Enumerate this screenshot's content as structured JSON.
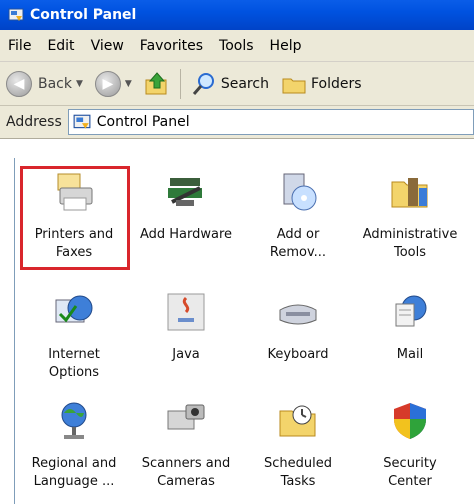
{
  "window": {
    "title": "Control Panel"
  },
  "menu": [
    "File",
    "Edit",
    "View",
    "Favorites",
    "Tools",
    "Help"
  ],
  "toolbar": {
    "back": "Back",
    "search": "Search",
    "folders": "Folders"
  },
  "address": {
    "label": "Address",
    "value": "Control Panel"
  },
  "items": [
    {
      "label1": "Printers and",
      "label2": "Faxes"
    },
    {
      "label1": "Add Hardware",
      "label2": ""
    },
    {
      "label1": "Add or",
      "label2": "Remov..."
    },
    {
      "label1": "Administrative",
      "label2": "Tools"
    },
    {
      "label1": "Internet",
      "label2": "Options"
    },
    {
      "label1": "Java",
      "label2": ""
    },
    {
      "label1": "Keyboard",
      "label2": ""
    },
    {
      "label1": "Mail",
      "label2": ""
    },
    {
      "label1": "Regional and",
      "label2": "Language ..."
    },
    {
      "label1": "Scanners and",
      "label2": "Cameras"
    },
    {
      "label1": "Scheduled",
      "label2": "Tasks"
    },
    {
      "label1": "Security",
      "label2": "Center"
    }
  ]
}
